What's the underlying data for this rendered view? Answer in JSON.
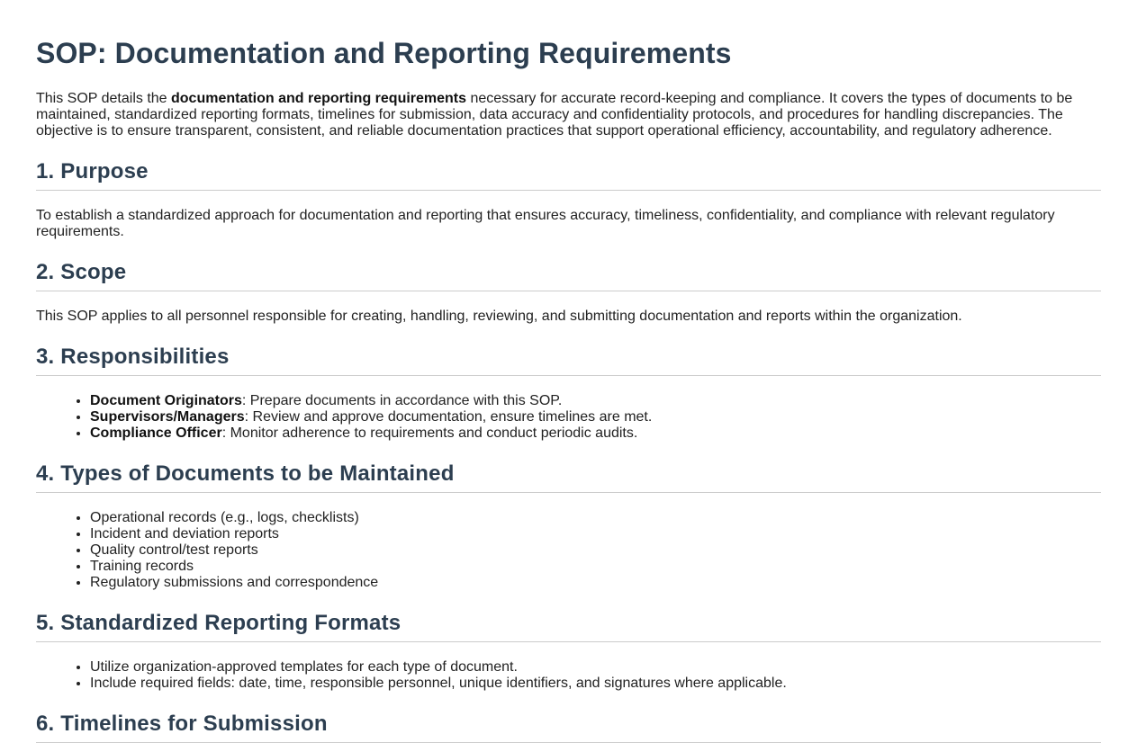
{
  "title": "SOP: Documentation and Reporting Requirements",
  "intro": {
    "before": "This SOP details the ",
    "bold": "documentation and reporting requirements",
    "after": " necessary for accurate record-keeping and compliance. It covers the types of documents to be maintained, standardized reporting formats, timelines for submission, data accuracy and confidentiality protocols, and procedures for handling discrepancies. The objective is to ensure transparent, consistent, and reliable documentation practices that support operational efficiency, accountability, and regulatory adherence."
  },
  "purpose": {
    "heading": "1. Purpose",
    "text": "To establish a standardized approach for documentation and reporting that ensures accuracy, timeliness, confidentiality, and compliance with relevant regulatory requirements."
  },
  "scope": {
    "heading": "2. Scope",
    "text": "This SOP applies to all personnel responsible for creating, handling, reviewing, and submitting documentation and reports within the organization."
  },
  "responsibilities": {
    "heading": "3. Responsibilities",
    "items": [
      {
        "role": "Document Originators",
        "desc": ": Prepare documents in accordance with this SOP."
      },
      {
        "role": "Supervisors/Managers",
        "desc": ": Review and approve documentation, ensure timelines are met."
      },
      {
        "role": "Compliance Officer",
        "desc": ": Monitor adherence to requirements and conduct periodic audits."
      }
    ]
  },
  "document_types": {
    "heading": "4. Types of Documents to be Maintained",
    "items": [
      "Operational records (e.g., logs, checklists)",
      "Incident and deviation reports",
      "Quality control/test reports",
      "Training records",
      "Regulatory submissions and correspondence"
    ]
  },
  "reporting_formats": {
    "heading": "5. Standardized Reporting Formats",
    "items": [
      "Utilize organization-approved templates for each type of document.",
      "Include required fields: date, time, responsible personnel, unique identifiers, and signatures where applicable."
    ]
  },
  "timelines": {
    "heading": "6. Timelines for Submission"
  }
}
